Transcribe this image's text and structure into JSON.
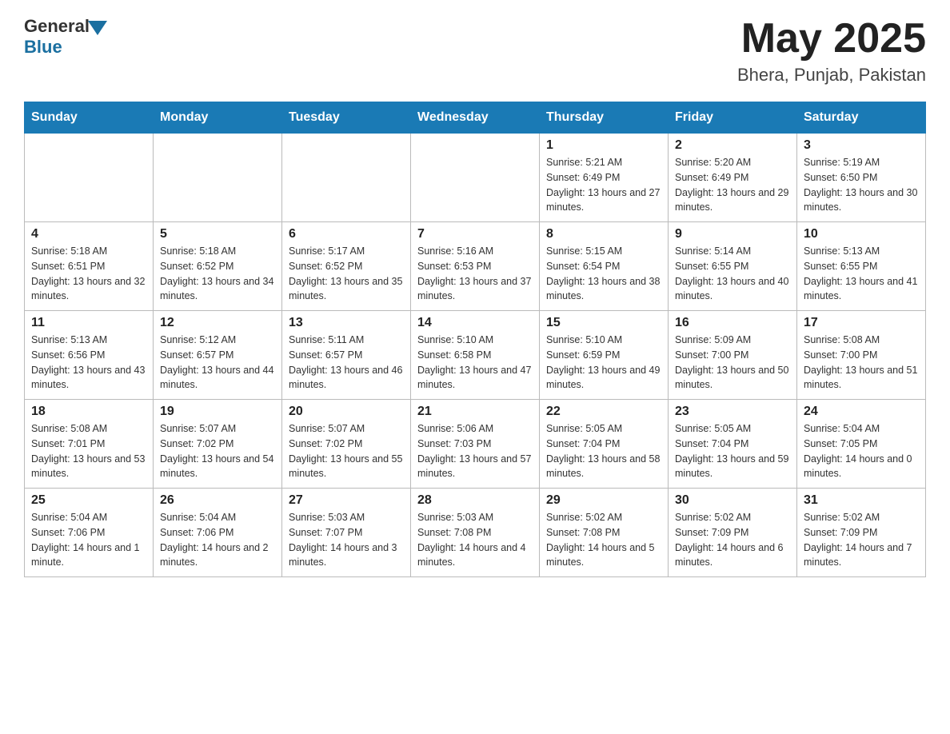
{
  "header": {
    "logo_general": "General",
    "logo_blue": "Blue",
    "month_year": "May 2025",
    "location": "Bhera, Punjab, Pakistan"
  },
  "days_of_week": [
    "Sunday",
    "Monday",
    "Tuesday",
    "Wednesday",
    "Thursday",
    "Friday",
    "Saturday"
  ],
  "weeks": [
    [
      {
        "day": "",
        "info": ""
      },
      {
        "day": "",
        "info": ""
      },
      {
        "day": "",
        "info": ""
      },
      {
        "day": "",
        "info": ""
      },
      {
        "day": "1",
        "info": "Sunrise: 5:21 AM\nSunset: 6:49 PM\nDaylight: 13 hours and 27 minutes."
      },
      {
        "day": "2",
        "info": "Sunrise: 5:20 AM\nSunset: 6:49 PM\nDaylight: 13 hours and 29 minutes."
      },
      {
        "day": "3",
        "info": "Sunrise: 5:19 AM\nSunset: 6:50 PM\nDaylight: 13 hours and 30 minutes."
      }
    ],
    [
      {
        "day": "4",
        "info": "Sunrise: 5:18 AM\nSunset: 6:51 PM\nDaylight: 13 hours and 32 minutes."
      },
      {
        "day": "5",
        "info": "Sunrise: 5:18 AM\nSunset: 6:52 PM\nDaylight: 13 hours and 34 minutes."
      },
      {
        "day": "6",
        "info": "Sunrise: 5:17 AM\nSunset: 6:52 PM\nDaylight: 13 hours and 35 minutes."
      },
      {
        "day": "7",
        "info": "Sunrise: 5:16 AM\nSunset: 6:53 PM\nDaylight: 13 hours and 37 minutes."
      },
      {
        "day": "8",
        "info": "Sunrise: 5:15 AM\nSunset: 6:54 PM\nDaylight: 13 hours and 38 minutes."
      },
      {
        "day": "9",
        "info": "Sunrise: 5:14 AM\nSunset: 6:55 PM\nDaylight: 13 hours and 40 minutes."
      },
      {
        "day": "10",
        "info": "Sunrise: 5:13 AM\nSunset: 6:55 PM\nDaylight: 13 hours and 41 minutes."
      }
    ],
    [
      {
        "day": "11",
        "info": "Sunrise: 5:13 AM\nSunset: 6:56 PM\nDaylight: 13 hours and 43 minutes."
      },
      {
        "day": "12",
        "info": "Sunrise: 5:12 AM\nSunset: 6:57 PM\nDaylight: 13 hours and 44 minutes."
      },
      {
        "day": "13",
        "info": "Sunrise: 5:11 AM\nSunset: 6:57 PM\nDaylight: 13 hours and 46 minutes."
      },
      {
        "day": "14",
        "info": "Sunrise: 5:10 AM\nSunset: 6:58 PM\nDaylight: 13 hours and 47 minutes."
      },
      {
        "day": "15",
        "info": "Sunrise: 5:10 AM\nSunset: 6:59 PM\nDaylight: 13 hours and 49 minutes."
      },
      {
        "day": "16",
        "info": "Sunrise: 5:09 AM\nSunset: 7:00 PM\nDaylight: 13 hours and 50 minutes."
      },
      {
        "day": "17",
        "info": "Sunrise: 5:08 AM\nSunset: 7:00 PM\nDaylight: 13 hours and 51 minutes."
      }
    ],
    [
      {
        "day": "18",
        "info": "Sunrise: 5:08 AM\nSunset: 7:01 PM\nDaylight: 13 hours and 53 minutes."
      },
      {
        "day": "19",
        "info": "Sunrise: 5:07 AM\nSunset: 7:02 PM\nDaylight: 13 hours and 54 minutes."
      },
      {
        "day": "20",
        "info": "Sunrise: 5:07 AM\nSunset: 7:02 PM\nDaylight: 13 hours and 55 minutes."
      },
      {
        "day": "21",
        "info": "Sunrise: 5:06 AM\nSunset: 7:03 PM\nDaylight: 13 hours and 57 minutes."
      },
      {
        "day": "22",
        "info": "Sunrise: 5:05 AM\nSunset: 7:04 PM\nDaylight: 13 hours and 58 minutes."
      },
      {
        "day": "23",
        "info": "Sunrise: 5:05 AM\nSunset: 7:04 PM\nDaylight: 13 hours and 59 minutes."
      },
      {
        "day": "24",
        "info": "Sunrise: 5:04 AM\nSunset: 7:05 PM\nDaylight: 14 hours and 0 minutes."
      }
    ],
    [
      {
        "day": "25",
        "info": "Sunrise: 5:04 AM\nSunset: 7:06 PM\nDaylight: 14 hours and 1 minute."
      },
      {
        "day": "26",
        "info": "Sunrise: 5:04 AM\nSunset: 7:06 PM\nDaylight: 14 hours and 2 minutes."
      },
      {
        "day": "27",
        "info": "Sunrise: 5:03 AM\nSunset: 7:07 PM\nDaylight: 14 hours and 3 minutes."
      },
      {
        "day": "28",
        "info": "Sunrise: 5:03 AM\nSunset: 7:08 PM\nDaylight: 14 hours and 4 minutes."
      },
      {
        "day": "29",
        "info": "Sunrise: 5:02 AM\nSunset: 7:08 PM\nDaylight: 14 hours and 5 minutes."
      },
      {
        "day": "30",
        "info": "Sunrise: 5:02 AM\nSunset: 7:09 PM\nDaylight: 14 hours and 6 minutes."
      },
      {
        "day": "31",
        "info": "Sunrise: 5:02 AM\nSunset: 7:09 PM\nDaylight: 14 hours and 7 minutes."
      }
    ]
  ]
}
